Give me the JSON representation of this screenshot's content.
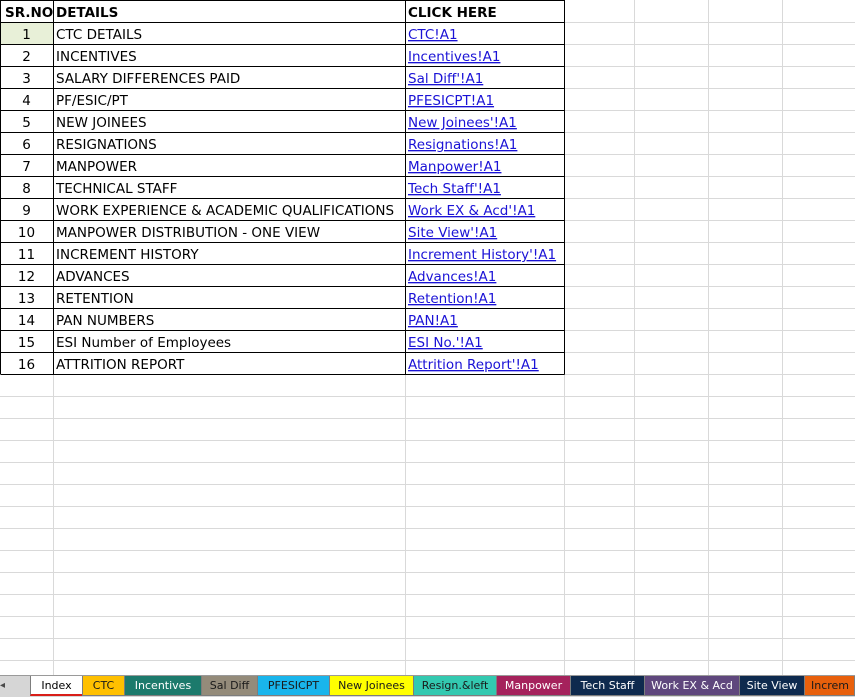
{
  "table": {
    "headers": [
      "SR.NO",
      "DETAILS",
      "CLICK HERE"
    ],
    "rows": [
      {
        "sr": "1",
        "details": "CTC DETAILS",
        "link": "CTC!A1"
      },
      {
        "sr": "2",
        "details": "INCENTIVES",
        "link": "Incentives!A1"
      },
      {
        "sr": "3",
        "details": "SALARY DIFFERENCES PAID",
        "link": "Sal Diff'!A1"
      },
      {
        "sr": "4",
        "details": "PF/ESIC/PT",
        "link": "PFESICPT!A1"
      },
      {
        "sr": "5",
        "details": "NEW JOINEES",
        "link": "New Joinees'!A1"
      },
      {
        "sr": "6",
        "details": "RESIGNATIONS",
        "link": "Resignations!A1"
      },
      {
        "sr": "7",
        "details": "MANPOWER",
        "link": "Manpower!A1"
      },
      {
        "sr": "8",
        "details": "TECHNICAL STAFF",
        "link": "Tech Staff'!A1"
      },
      {
        "sr": "9",
        "details": "WORK EXPERIENCE & ACADEMIC QUALIFICATIONS",
        "link": "Work EX & Acd'!A1"
      },
      {
        "sr": "10",
        "details": "MANPOWER DISTRIBUTION - ONE VIEW",
        "link": "Site View'!A1"
      },
      {
        "sr": "11",
        "details": "INCREMENT HISTORY",
        "link": "Increment History'!A1"
      },
      {
        "sr": "12",
        "details": "ADVANCES",
        "link": "Advances!A1"
      },
      {
        "sr": "13",
        "details": "RETENTION",
        "link": "Retention!A1"
      },
      {
        "sr": "14",
        "details": "PAN NUMBERS",
        "link": "PAN!A1"
      },
      {
        "sr": "15",
        "details": "ESI Number of Employees",
        "link": "ESI No.'!A1"
      },
      {
        "sr": "16",
        "details": "ATTRITION REPORT",
        "link": "Attrition Report'!A1"
      }
    ]
  },
  "colors": {
    "gridline": "#d9d9d9",
    "border": "#000000",
    "link": "#1a12d6",
    "text": "#000000",
    "active_cell": "#e8f0d8"
  },
  "tabs": [
    {
      "label": "Index",
      "color": "#ffffff",
      "text_color": "#000000",
      "active": true
    },
    {
      "label": "CTC",
      "color": "#ffc000",
      "text_color": "#1a1a1a"
    },
    {
      "label": "Incentives",
      "color": "#1c7a6c",
      "text_color": "#ffffff"
    },
    {
      "label": "Sal Diff",
      "color": "#948b7a",
      "text_color": "#1a1a1a"
    },
    {
      "label": "PFESICPT",
      "color": "#19b5ec",
      "text_color": "#1a1a1a"
    },
    {
      "label": "New Joinees",
      "color": "#ffff00",
      "text_color": "#1a1a1a"
    },
    {
      "label": "Resign.&left",
      "color": "#33c9b0",
      "text_color": "#1a1a1a"
    },
    {
      "label": "Manpower",
      "color": "#a5225c",
      "text_color": "#ffffff"
    },
    {
      "label": "Tech Staff",
      "color": "#0e2a4e",
      "text_color": "#ffffff"
    },
    {
      "label": "Work EX & Acd",
      "color": "#5f477d",
      "text_color": "#ffffff"
    },
    {
      "label": "Site View",
      "color": "#0e2a4e",
      "text_color": "#ffffff"
    },
    {
      "label": "Increm",
      "color": "#e8600c",
      "text_color": "#1a1a1a"
    }
  ],
  "icons": {
    "tab_scroll": "chevron-left-icon"
  }
}
